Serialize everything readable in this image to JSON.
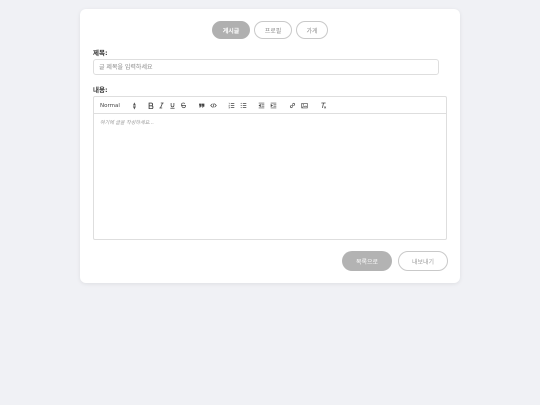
{
  "tabs": [
    {
      "label": "게시글",
      "active": true
    },
    {
      "label": "프로필",
      "active": false
    },
    {
      "label": "가게",
      "active": false
    }
  ],
  "form": {
    "title_label": "제목:",
    "title_placeholder": "글 제목을 입력하세요",
    "content_label": "내용:",
    "editor_placeholder": "여기에 글을 작성하세요..."
  },
  "toolbar": {
    "header_select_value": "Normal",
    "icons": [
      "bold-icon",
      "italic-icon",
      "underline-icon",
      "strike-icon",
      "blockquote-icon",
      "code-icon",
      "ordered-list-icon",
      "bullet-list-icon",
      "outdent-icon",
      "indent-icon",
      "link-icon",
      "image-icon",
      "clear-format-icon"
    ]
  },
  "actions": {
    "list_label": "목록으로",
    "export_label": "내보내기"
  },
  "colors": {
    "background": "#f0f1f5",
    "card": "#ffffff",
    "active_tab": "#b0b0b0",
    "primary_button": "#b3b3b3"
  }
}
